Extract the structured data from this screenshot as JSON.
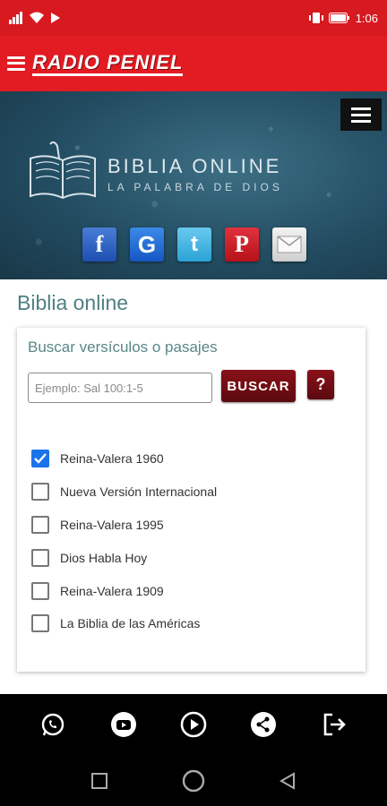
{
  "status_bar": {
    "time": "1:06",
    "battery_icon": "battery-icon",
    "colors": {
      "bar": "#d71920"
    }
  },
  "app_bar": {
    "brand": "RADIO PENIEL",
    "menu_icon": "hamburger-icon",
    "background": "#e31b23"
  },
  "banner": {
    "title": "BIBLIA ONLINE",
    "subtitle": "LA PALABRA DE DIOS",
    "menu_icon": "hamburger-icon",
    "social": [
      {
        "name": "facebook",
        "glyph": "f"
      },
      {
        "name": "google",
        "glyph": "G"
      },
      {
        "name": "twitter",
        "glyph": "t"
      },
      {
        "name": "pinterest",
        "glyph": "P"
      },
      {
        "name": "email",
        "glyph": ""
      }
    ]
  },
  "main": {
    "page_title": "Biblia online",
    "search": {
      "title": "Buscar versículos o pasajes",
      "placeholder": "Ejemplo: Sal 100:1-5",
      "value": "",
      "button_label": "BUSCAR",
      "help_label": "?"
    },
    "versions": [
      {
        "label": "Reina-Valera 1960",
        "checked": true
      },
      {
        "label": "Nueva Versión Internacional",
        "checked": false
      },
      {
        "label": "Reina-Valera 1995",
        "checked": false
      },
      {
        "label": "Dios Habla Hoy",
        "checked": false
      },
      {
        "label": "Reina-Valera 1909",
        "checked": false
      },
      {
        "label": "La Biblia de las Américas",
        "checked": false
      }
    ]
  },
  "bottom_bar": {
    "buttons": [
      "whatsapp-icon",
      "youtube-icon",
      "play-icon",
      "share-icon",
      "exit-icon"
    ]
  },
  "nav_bar": {
    "buttons": [
      "recent-apps-icon",
      "home-icon",
      "back-icon"
    ]
  },
  "colors": {
    "accent_red": "#e31b23",
    "dark_red_button": "#6e0d13",
    "title_teal": "#4f7f82",
    "checkbox_blue": "#1a73e8"
  }
}
